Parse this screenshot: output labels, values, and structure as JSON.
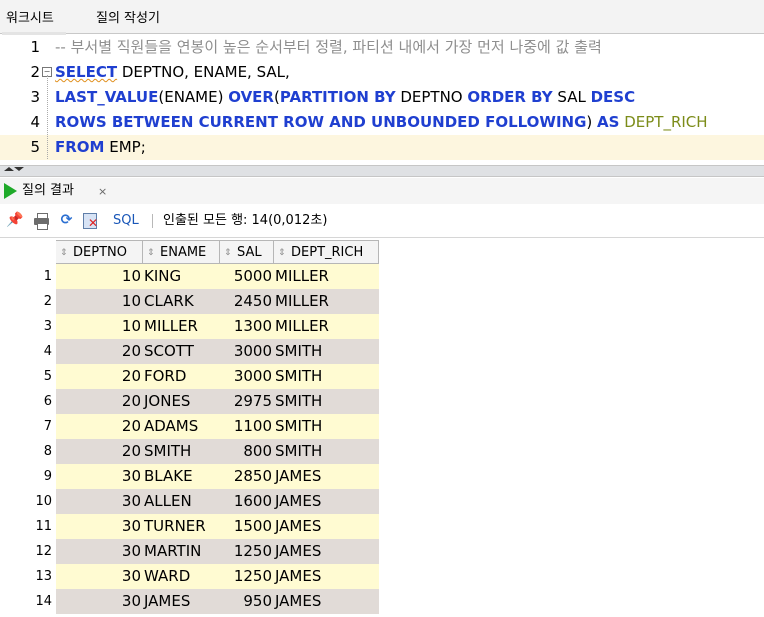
{
  "tabs": [
    {
      "label": "워크시트"
    },
    {
      "label": "질의 작성기"
    }
  ],
  "editor": {
    "lines": [
      {
        "num": "1",
        "comment": "-- 부서별 직원들을 연봉이 높은 순서부터 정렬, 파티션 내에서 가장 먼저 나중에 값 출력"
      },
      {
        "num": "2",
        "kw1": "SELECT",
        "rest": " DEPTNO, ENAME, SAL,"
      },
      {
        "num": "3",
        "kw1": "LAST_VALUE",
        "t1": "(ENAME) ",
        "kw2": "OVER",
        "t2": "(",
        "kw3": "PARTITION BY",
        "t3": " DEPTNO ",
        "kw4": "ORDER BY",
        "t4": " SAL ",
        "kw5": "DESC"
      },
      {
        "num": "4",
        "kw1": "ROWS BETWEEN CURRENT ROW AND UNBOUNDED FOLLOWING",
        "t1": ") ",
        "kw2": "AS",
        "alias": " DEPT_RICH"
      },
      {
        "num": "5",
        "kw1": "FROM",
        "rest": " EMP;"
      }
    ]
  },
  "results": {
    "tab_label": "질의 결과",
    "close_label": "×",
    "sql_label": "SQL",
    "fetched_text": "인출된 모든 행: 14(0,012초)",
    "columns": [
      "DEPTNO",
      "ENAME",
      "SAL",
      "DEPT_RICH"
    ],
    "rows": [
      {
        "n": "1",
        "deptno": "10",
        "ename": "KING",
        "sal": "5000",
        "rich": "MILLER"
      },
      {
        "n": "2",
        "deptno": "10",
        "ename": "CLARK",
        "sal": "2450",
        "rich": "MILLER"
      },
      {
        "n": "3",
        "deptno": "10",
        "ename": "MILLER",
        "sal": "1300",
        "rich": "MILLER"
      },
      {
        "n": "4",
        "deptno": "20",
        "ename": "SCOTT",
        "sal": "3000",
        "rich": "SMITH"
      },
      {
        "n": "5",
        "deptno": "20",
        "ename": "FORD",
        "sal": "3000",
        "rich": "SMITH"
      },
      {
        "n": "6",
        "deptno": "20",
        "ename": "JONES",
        "sal": "2975",
        "rich": "SMITH"
      },
      {
        "n": "7",
        "deptno": "20",
        "ename": "ADAMS",
        "sal": "1100",
        "rich": "SMITH"
      },
      {
        "n": "8",
        "deptno": "20",
        "ename": "SMITH",
        "sal": "800",
        "rich": "SMITH"
      },
      {
        "n": "9",
        "deptno": "30",
        "ename": "BLAKE",
        "sal": "2850",
        "rich": "JAMES"
      },
      {
        "n": "10",
        "deptno": "30",
        "ename": "ALLEN",
        "sal": "1600",
        "rich": "JAMES"
      },
      {
        "n": "11",
        "deptno": "30",
        "ename": "TURNER",
        "sal": "1500",
        "rich": "JAMES"
      },
      {
        "n": "12",
        "deptno": "30",
        "ename": "MARTIN",
        "sal": "1250",
        "rich": "JAMES"
      },
      {
        "n": "13",
        "deptno": "30",
        "ename": "WARD",
        "sal": "1250",
        "rich": "JAMES"
      },
      {
        "n": "14",
        "deptno": "30",
        "ename": "JAMES",
        "sal": "950",
        "rich": "JAMES"
      }
    ]
  },
  "colors": {
    "keyword": "#1f3fd0",
    "comment": "#8f8f8f",
    "alias": "#7c8c19",
    "row_odd": "#fffbd2",
    "row_even": "#e1dbd7",
    "run_icon": "#1faa2a"
  },
  "icons": [
    "pin-icon",
    "print-icon",
    "refresh-icon",
    "cancel-icon",
    "run-icon",
    "sort-icon"
  ]
}
